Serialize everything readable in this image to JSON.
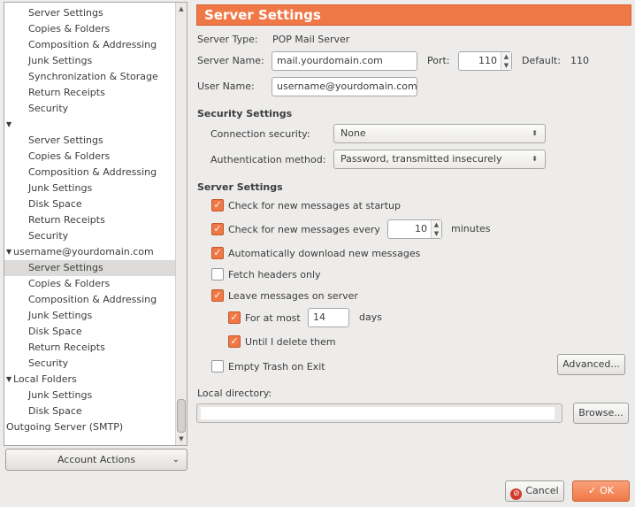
{
  "tree": {
    "items": [
      {
        "label": "Server Settings",
        "level": "child"
      },
      {
        "label": "Copies & Folders",
        "level": "child"
      },
      {
        "label": "Composition & Addressing",
        "level": "child"
      },
      {
        "label": "Junk Settings",
        "level": "child"
      },
      {
        "label": "Synchronization & Storage",
        "level": "child"
      },
      {
        "label": "Return Receipts",
        "level": "child"
      },
      {
        "label": "Security",
        "level": "child"
      },
      {
        "label": "",
        "level": "top",
        "expander": "▼"
      },
      {
        "label": "Server Settings",
        "level": "child"
      },
      {
        "label": "Copies & Folders",
        "level": "child"
      },
      {
        "label": "Composition & Addressing",
        "level": "child"
      },
      {
        "label": "Junk Settings",
        "level": "child"
      },
      {
        "label": "Disk Space",
        "level": "child"
      },
      {
        "label": "Return Receipts",
        "level": "child"
      },
      {
        "label": "Security",
        "level": "child"
      },
      {
        "label": "username@yourdomain.com",
        "level": "top",
        "expander": "▼"
      },
      {
        "label": "Server Settings",
        "level": "child",
        "selected": true
      },
      {
        "label": "Copies & Folders",
        "level": "child"
      },
      {
        "label": "Composition & Addressing",
        "level": "child"
      },
      {
        "label": "Junk Settings",
        "level": "child"
      },
      {
        "label": "Disk Space",
        "level": "child"
      },
      {
        "label": "Return Receipts",
        "level": "child"
      },
      {
        "label": "Security",
        "level": "child"
      },
      {
        "label": "Local Folders",
        "level": "top",
        "expander": "▼"
      },
      {
        "label": "Junk Settings",
        "level": "child"
      },
      {
        "label": "Disk Space",
        "level": "child"
      },
      {
        "label": "Outgoing Server (SMTP)",
        "level": "top",
        "expander": ""
      }
    ]
  },
  "account_actions": {
    "label": "Account Actions",
    "icon": "chevron-down-icon"
  },
  "header": {
    "title": "Server Settings"
  },
  "server": {
    "type_label": "Server Type:",
    "type_value": "POP Mail Server",
    "name_label": "Server Name:",
    "name_value": "mail.yourdomain.com",
    "port_label": "Port:",
    "port_value": "110",
    "default_label": "Default:",
    "default_value": "110",
    "user_label": "User Name:",
    "user_value": "username@yourdomain.com"
  },
  "security": {
    "heading": "Security Settings",
    "connection_label": "Connection security:",
    "connection_value": "None",
    "auth_label": "Authentication method:",
    "auth_value": "Password, transmitted insecurely"
  },
  "settings": {
    "heading": "Server Settings",
    "check_startup": {
      "label": "Check for new messages at startup",
      "checked": true
    },
    "check_every": {
      "label": "Check for new messages every",
      "checked": true,
      "value": "10",
      "unit": "minutes"
    },
    "auto_download": {
      "label": "Automatically download new messages",
      "checked": true
    },
    "fetch_headers": {
      "label": "Fetch headers only",
      "checked": false
    },
    "leave_on_server": {
      "label": "Leave messages on server",
      "checked": true
    },
    "for_at_most": {
      "label": "For at most",
      "checked": true,
      "value": "14",
      "unit": "days"
    },
    "until_delete": {
      "label": "Until I delete them",
      "checked": true
    },
    "empty_trash": {
      "label": "Empty Trash on Exit",
      "checked": false
    },
    "advanced_label": "Advanced..."
  },
  "local_dir": {
    "label": "Local directory:",
    "value": "",
    "browse_label": "Browse..."
  },
  "footer": {
    "cancel_label": "Cancel",
    "ok_label": "OK"
  },
  "colors": {
    "accent": "#f07746",
    "selected_row": "#dcdbd9",
    "background": "#edeceb"
  }
}
